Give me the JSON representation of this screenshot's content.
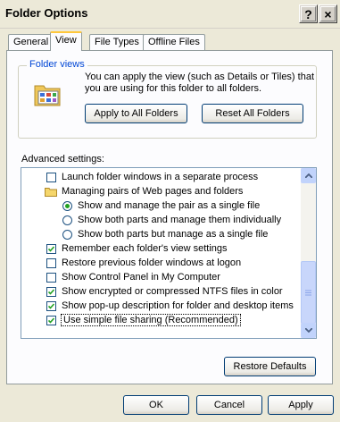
{
  "window": {
    "title": "Folder Options",
    "help_label": "?",
    "close_label": "×"
  },
  "tabs": [
    {
      "label": "General"
    },
    {
      "label": "View"
    },
    {
      "label": "File Types"
    },
    {
      "label": "Offline Files"
    }
  ],
  "folder_views": {
    "title": "Folder views",
    "description": "You can apply the view (such as Details or Tiles) that you are using for this folder to all folders.",
    "apply_label": "Apply to All Folders",
    "reset_label": "Reset All Folders"
  },
  "advanced": {
    "label": "Advanced settings:",
    "items": [
      {
        "type": "checkbox",
        "checked": false,
        "label": "Launch folder windows in a separate process"
      },
      {
        "type": "folder",
        "label": "Managing pairs of Web pages and folders"
      },
      {
        "type": "radio",
        "checked": true,
        "label": "Show and manage the pair as a single file"
      },
      {
        "type": "radio",
        "checked": false,
        "label": "Show both parts and manage them individually"
      },
      {
        "type": "radio",
        "checked": false,
        "label": "Show both parts but manage as a single file"
      },
      {
        "type": "checkbox",
        "checked": true,
        "label": "Remember each folder's view settings"
      },
      {
        "type": "checkbox",
        "checked": false,
        "label": "Restore previous folder windows at logon"
      },
      {
        "type": "checkbox",
        "checked": false,
        "label": "Show Control Panel in My Computer"
      },
      {
        "type": "checkbox",
        "checked": true,
        "label": "Show encrypted or compressed NTFS files in color"
      },
      {
        "type": "checkbox",
        "checked": true,
        "label": "Show pop-up description for folder and desktop items"
      },
      {
        "type": "checkbox",
        "checked": true,
        "label": "Use simple file sharing (Recommended)"
      }
    ],
    "restore_label": "Restore Defaults"
  },
  "buttons": {
    "ok": "OK",
    "cancel": "Cancel",
    "apply": "Apply"
  }
}
